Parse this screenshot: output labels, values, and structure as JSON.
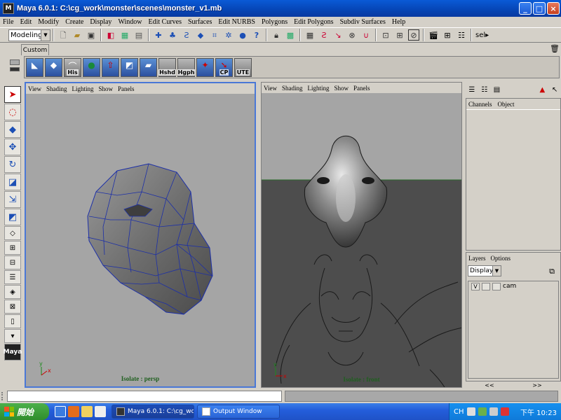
{
  "window": {
    "title": "Maya 6.0.1: C:\\cg_work\\monster\\scenes\\monster_v1.mb",
    "app_icon": "M",
    "controls": {
      "minimize": "_",
      "maximize": "□",
      "close": "×"
    }
  },
  "menubar": [
    "File",
    "Edit",
    "Modify",
    "Create",
    "Display",
    "Window",
    "Edit Curves",
    "Surfaces",
    "Edit NURBS",
    "Polygons",
    "Edit Polygons",
    "Subdiv Surfaces",
    "Help"
  ],
  "statusline": {
    "mode": "Modeling",
    "sel_label": "sel▸",
    "icons": [
      "new-scene-icon",
      "open-scene-icon",
      "save-scene-icon",
      "select-hierarchy-icon",
      "select-object-icon",
      "select-component-icon",
      "snap-grid-icon",
      "snap-curve-icon",
      "snap-point-icon",
      "snap-plane-icon",
      "snap-live-icon",
      "construction-history-icon",
      "help-icon",
      "lock-icon",
      "unlock-icon",
      "input-ops-icon",
      "output-ops-icon",
      "render-icon",
      "ipr-render-icon",
      "render-globals-icon"
    ]
  },
  "shelf": {
    "tab": "Custom",
    "buttons": [
      {
        "name": "create-poly-icon",
        "label": ""
      },
      {
        "name": "split-poly-icon",
        "label": ""
      },
      {
        "name": "history-icon",
        "label": "His"
      },
      {
        "name": "sphere-icon",
        "label": ""
      },
      {
        "name": "extrude-face-icon",
        "label": ""
      },
      {
        "name": "extrude-edge-icon",
        "label": ""
      },
      {
        "name": "merge-icon",
        "label": ""
      },
      {
        "name": "hide-shade-icon",
        "label": "Hshd"
      },
      {
        "name": "hypergraph-icon",
        "label": "Hgph"
      },
      {
        "name": "pivot-icon",
        "label": ""
      },
      {
        "name": "cp-icon",
        "label": "CP"
      },
      {
        "name": "ute-icon",
        "label": "UTE"
      }
    ]
  },
  "toolbox": [
    "select-tool-icon",
    "lasso-tool-icon",
    "paint-select-icon",
    "move-tool-icon",
    "rotate-tool-icon",
    "scale-tool-icon",
    "manipulator-icon",
    "last-tool-icon",
    "single-pane-icon",
    "four-pane-icon",
    "two-pane-icon",
    "outliner-layout-icon",
    "graph-layout-icon",
    "persp-outliner-icon",
    "custom-layout-icon",
    "expand-icon",
    "maya-logo-icon"
  ],
  "toolbox_logo": "Maya",
  "viewports": {
    "menu": [
      "View",
      "Shading",
      "Lighting",
      "Show",
      "Panels"
    ],
    "persp": {
      "caption": "Isolate : persp"
    },
    "front": {
      "caption": "Isolate : front"
    },
    "axis": {
      "y": "y",
      "x": "x"
    }
  },
  "channel_box": {
    "menu": [
      "Channels",
      "Object"
    ]
  },
  "layers": {
    "menu": [
      "Layers",
      "Options"
    ],
    "display": "Display",
    "rows": [
      {
        "v": "V",
        "name": "cam"
      }
    ],
    "scroll_left": "<<",
    "scroll_right": ">>"
  },
  "taskbar": {
    "start": "開始",
    "tasks": [
      {
        "label": "Maya 6.0.1: C:\\cg_wo...",
        "active": true
      },
      {
        "label": "Output Window",
        "active": false
      }
    ],
    "tray_lang": "CH",
    "clock": "下午 10:23"
  },
  "colors": {
    "titlebar": "#0645b5",
    "viewport_bg": "#a5a5a5",
    "front_floor": "#4d4d4d",
    "mesh_wire": "#1c2fa8",
    "active_border": "#4a78d6"
  }
}
